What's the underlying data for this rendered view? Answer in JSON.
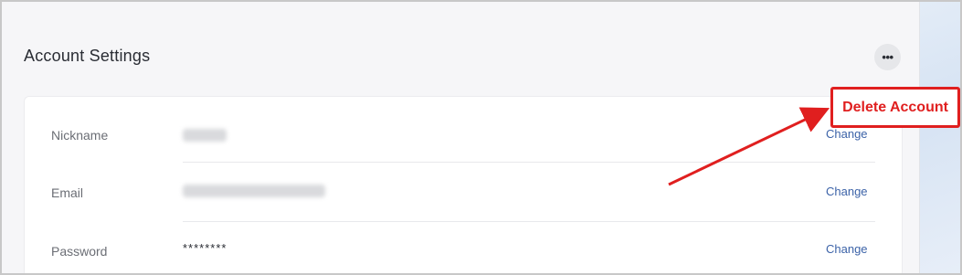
{
  "page": {
    "title": "Account Settings",
    "more_icon": "more-horizontal-icon",
    "more_glyph": "•••"
  },
  "settings": [
    {
      "label": "Nickname",
      "value": "",
      "masked": true,
      "action": "Change"
    },
    {
      "label": "Email",
      "value": "",
      "masked": true,
      "action": "Change"
    },
    {
      "label": "Password",
      "value": "********",
      "masked": false,
      "action": "Change"
    }
  ],
  "annotation": {
    "text": "Delete Account",
    "color": "#e01f1f"
  },
  "colors": {
    "link": "#3c63a8",
    "accent_red": "#e01f1f"
  }
}
